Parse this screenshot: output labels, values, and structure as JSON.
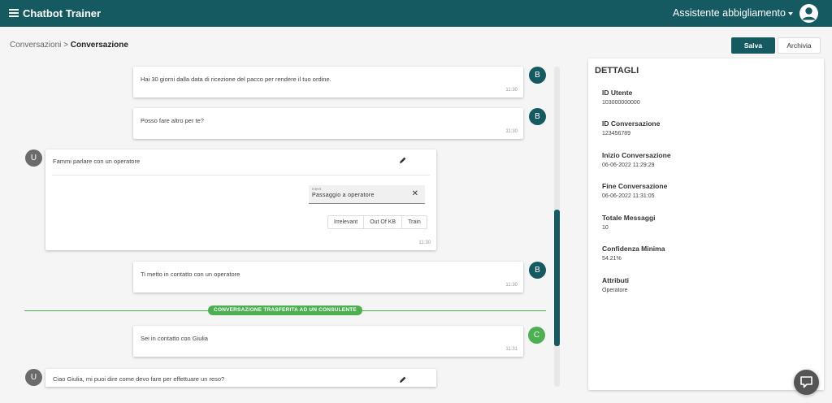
{
  "app": {
    "title": "Chatbot Trainer",
    "assistant": "Assistente abbigliamento"
  },
  "breadcrumb": {
    "parent": "Conversazioni",
    "separator": " > ",
    "current": "Conversazione"
  },
  "actions": {
    "save": "Salva",
    "archive": "Archivia"
  },
  "colors": {
    "primary": "#145a60",
    "bot": "#145a60",
    "user": "#6b6b6b",
    "consultant": "#4caf50"
  },
  "messages": [
    {
      "sender": "B",
      "text": "Hai 30 giorni dalla data di ricezione del pacco per rendere il tuo ordine.",
      "time": "11:30"
    },
    {
      "sender": "B",
      "text": "Posso fare altro per te?",
      "time": "11:30"
    },
    {
      "sender": "U",
      "text": "Fammi parlare con un operatore",
      "time": "11:30",
      "intent_label": "Intent",
      "intent_value": "Passaggio a operatore",
      "actions": [
        "Irrelevant",
        "Out Of KB",
        "Train"
      ]
    },
    {
      "sender": "B",
      "text": "Ti metto in contatto con un operatore",
      "time": "11:30"
    },
    {
      "sender": "C",
      "text": "Sei in contatto con Giulia",
      "time": "11:31"
    },
    {
      "sender": "U",
      "text": "Ciao Giulia, mi puoi dire come devo fare per effettuare un reso?"
    }
  ],
  "transfer_banner": "CONVERSAZIONE TRASFERITA AD UN CONSULENTE",
  "details": {
    "title": "DETTAGLI",
    "items": [
      {
        "label": "ID Utente",
        "value": "103000000000"
      },
      {
        "label": "ID Conversazione",
        "value": "123456789"
      },
      {
        "label": "Inizio Conversazione",
        "value": "06-06-2022 11:29:29"
      },
      {
        "label": "Fine Conversazione",
        "value": "06-06-2022 11:31:05"
      },
      {
        "label": "Totale Messaggi",
        "value": "10"
      },
      {
        "label": "Confidenza Minima",
        "value": "54.21%"
      },
      {
        "label": "Attributi",
        "value": "Operatore"
      }
    ]
  }
}
